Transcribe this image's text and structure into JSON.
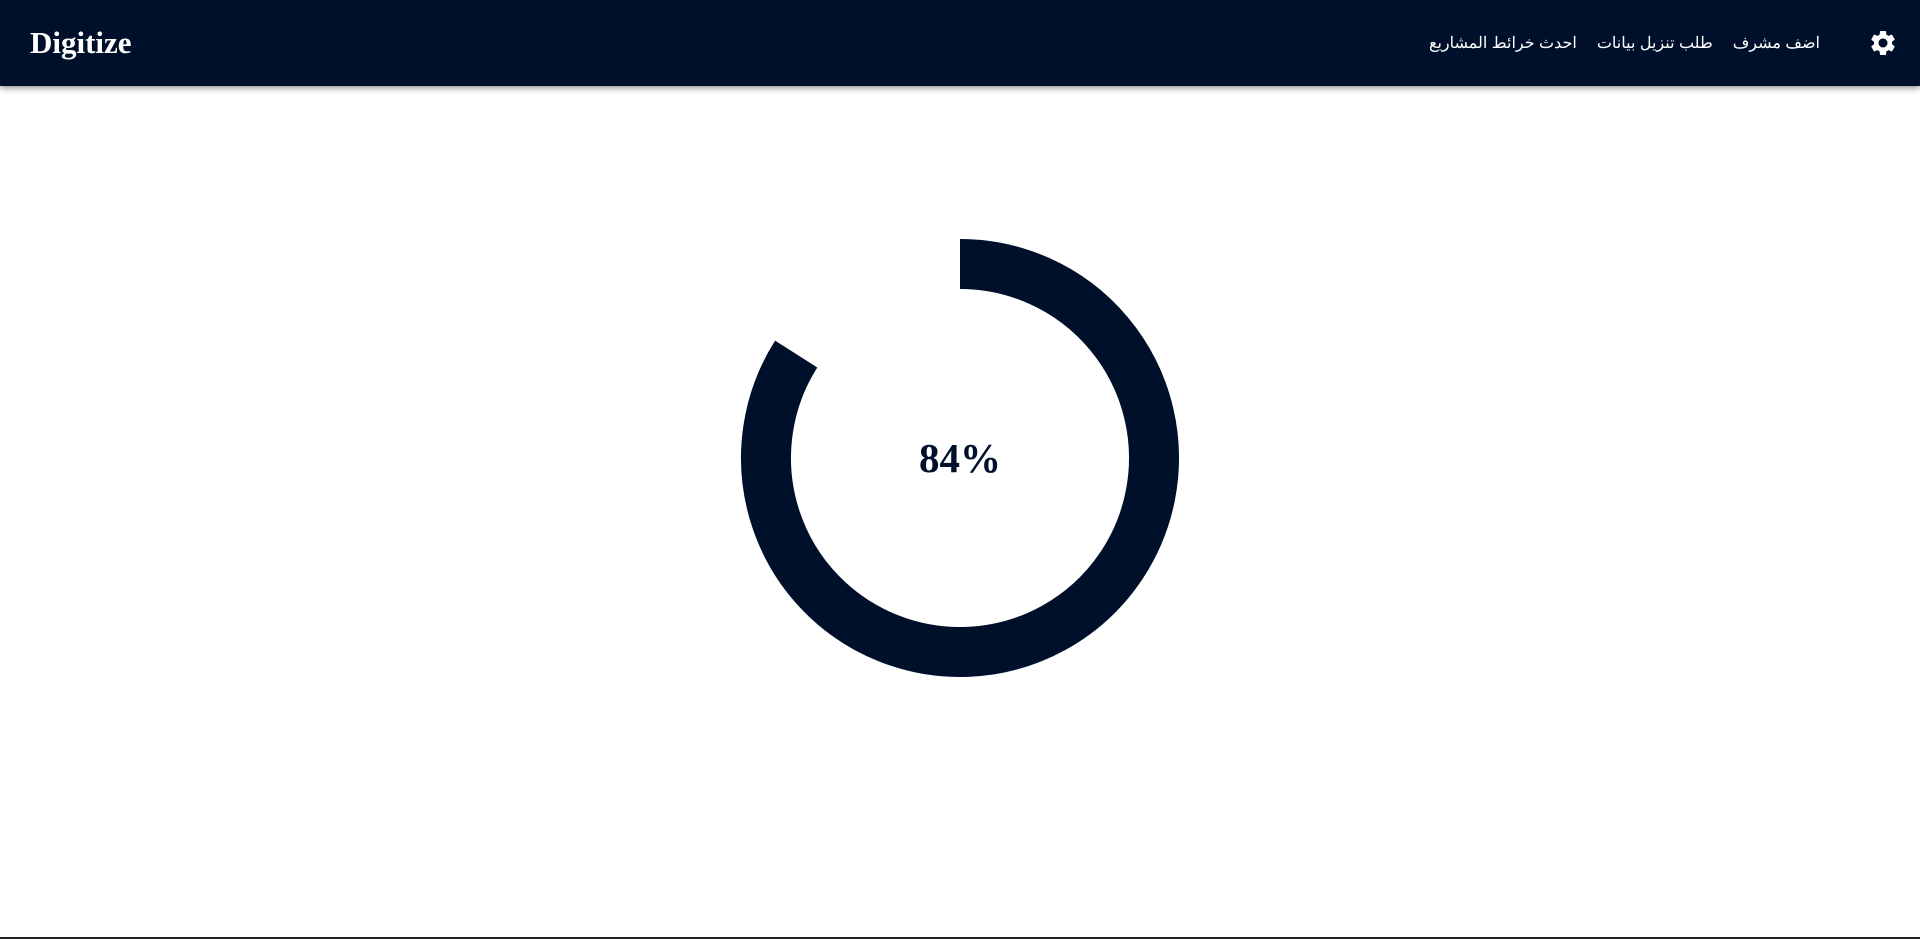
{
  "navbar": {
    "brand": "Digitize",
    "links": [
      {
        "label": "اضف مشرف"
      },
      {
        "label": "طلب تنزيل بيانات"
      },
      {
        "label": "احدث خرائط المشاريع"
      }
    ],
    "settings_icon": "gear-icon"
  },
  "progress": {
    "value": 84,
    "label": "84%"
  },
  "colors": {
    "navbar_bg": "#00102a",
    "accent": "#00102a",
    "text_on_dark": "#ffffff"
  }
}
